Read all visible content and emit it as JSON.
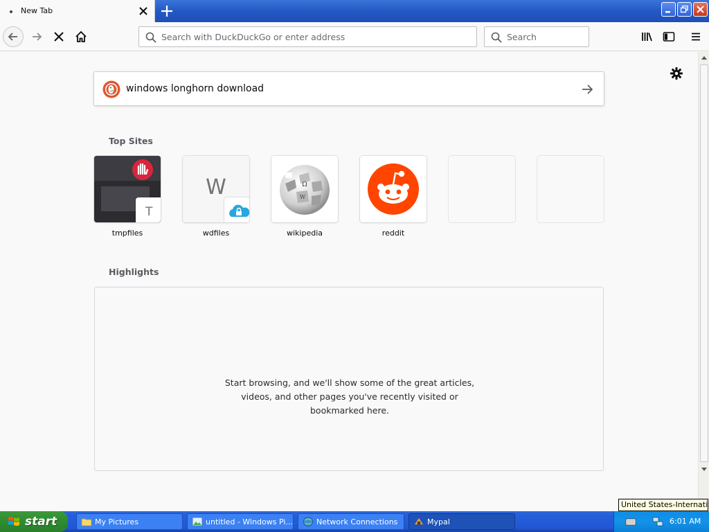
{
  "browser": {
    "tab": {
      "title": "New Tab"
    },
    "urlbar": {
      "placeholder": "Search with DuckDuckGo or enter address"
    },
    "searchbar": {
      "placeholder": "Search"
    }
  },
  "newtab": {
    "search_query": "windows longhorn download",
    "top_sites_title": "Top Sites",
    "top_sites": [
      {
        "label": "tmpfiles",
        "badge_letter": "T"
      },
      {
        "label": "wdfiles",
        "tile_letter": "W"
      },
      {
        "label": "wikipedia"
      },
      {
        "label": "reddit"
      },
      {
        "label": ""
      },
      {
        "label": ""
      }
    ],
    "highlights_title": "Highlights",
    "highlights_message": "Start browsing, and we'll show some of the great articles, videos, and other pages you've recently visited or bookmarked here."
  },
  "taskbar": {
    "start_label": "start",
    "tasks": [
      {
        "label": "My Pictures"
      },
      {
        "label": "untitled - Windows Pi..."
      },
      {
        "label": "Network Connections"
      },
      {
        "label": "Mypal",
        "active": true
      }
    ],
    "clock": "6:01 AM",
    "language_tooltip": "United States-International"
  },
  "colors": {
    "titlebar_blue": "#2458c4",
    "reddit_orange": "#ff4500",
    "ddg_orange": "#de5833",
    "start_green": "#3c9a3c"
  }
}
